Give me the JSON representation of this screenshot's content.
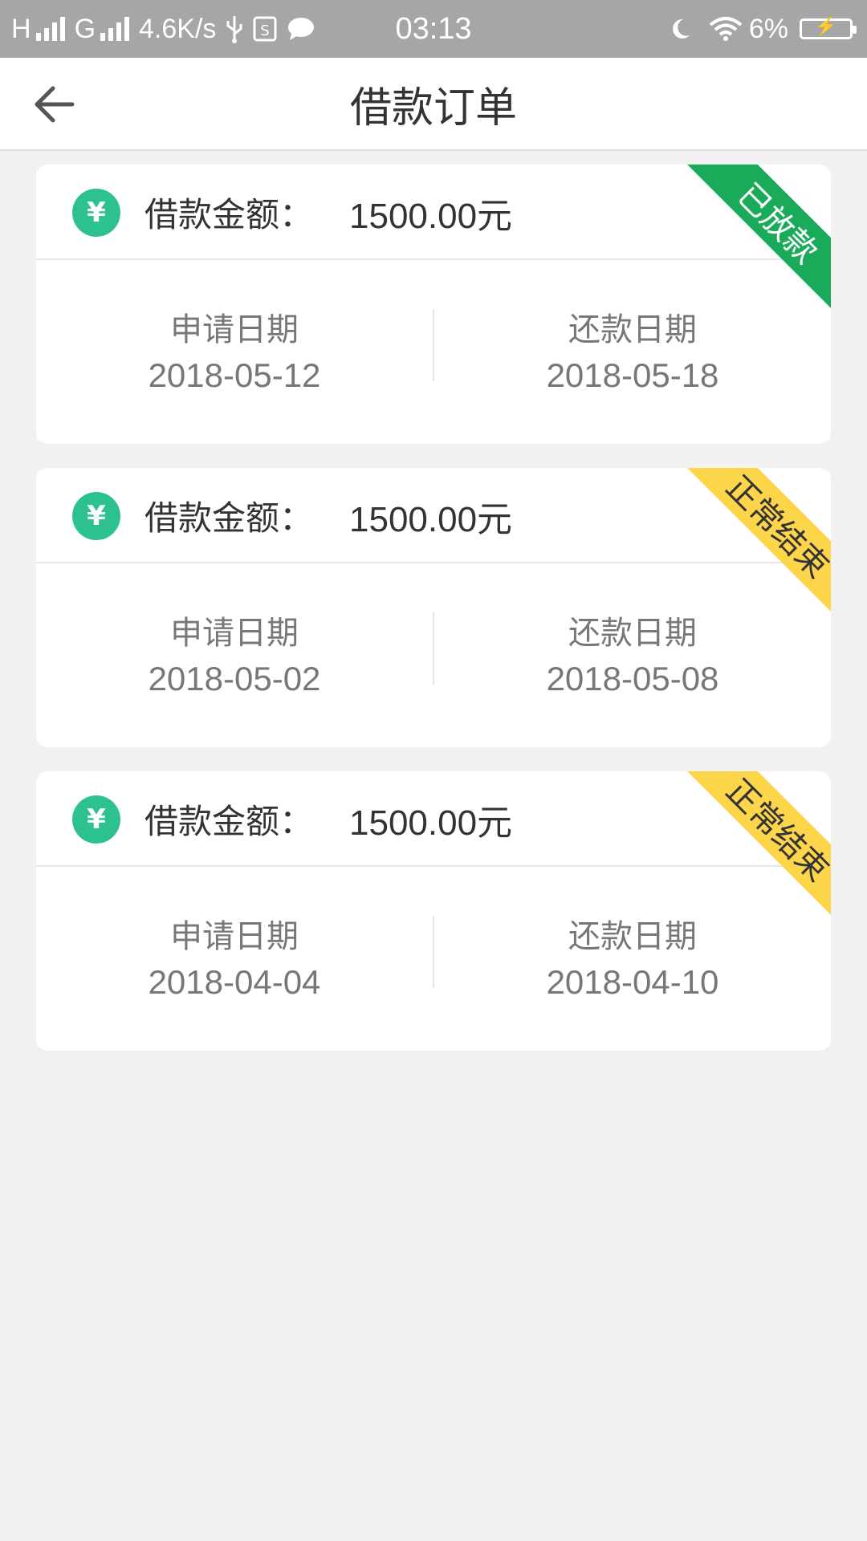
{
  "status_bar": {
    "carrier_left": "H",
    "carrier_right": "G",
    "speed": "4.6K/s",
    "time": "03:13",
    "battery": "6%"
  },
  "header": {
    "title": "借款订单"
  },
  "orders": [
    {
      "amount_label": "借款金额：",
      "amount_value": "1500.00元",
      "status": "已放款",
      "status_color": "#1aab5a",
      "apply_label": "申请日期",
      "apply_date": "2018-05-12",
      "repay_label": "还款日期",
      "repay_date": "2018-05-18"
    },
    {
      "amount_label": "借款金额：",
      "amount_value": "1500.00元",
      "status": "正常结束",
      "status_color": "#fdd54b",
      "apply_label": "申请日期",
      "apply_date": "2018-05-02",
      "repay_label": "还款日期",
      "repay_date": "2018-05-08"
    },
    {
      "amount_label": "借款金额：",
      "amount_value": "1500.00元",
      "status": "正常结束",
      "status_color": "#fdd54b",
      "apply_label": "申请日期",
      "apply_date": "2018-04-04",
      "repay_label": "还款日期",
      "repay_date": "2018-04-10"
    }
  ],
  "icons": {
    "currency": "¥"
  },
  "colors": {
    "accent": "#2ec190",
    "background": "#f1f1f1",
    "status_bar": "#a6a6a6"
  }
}
